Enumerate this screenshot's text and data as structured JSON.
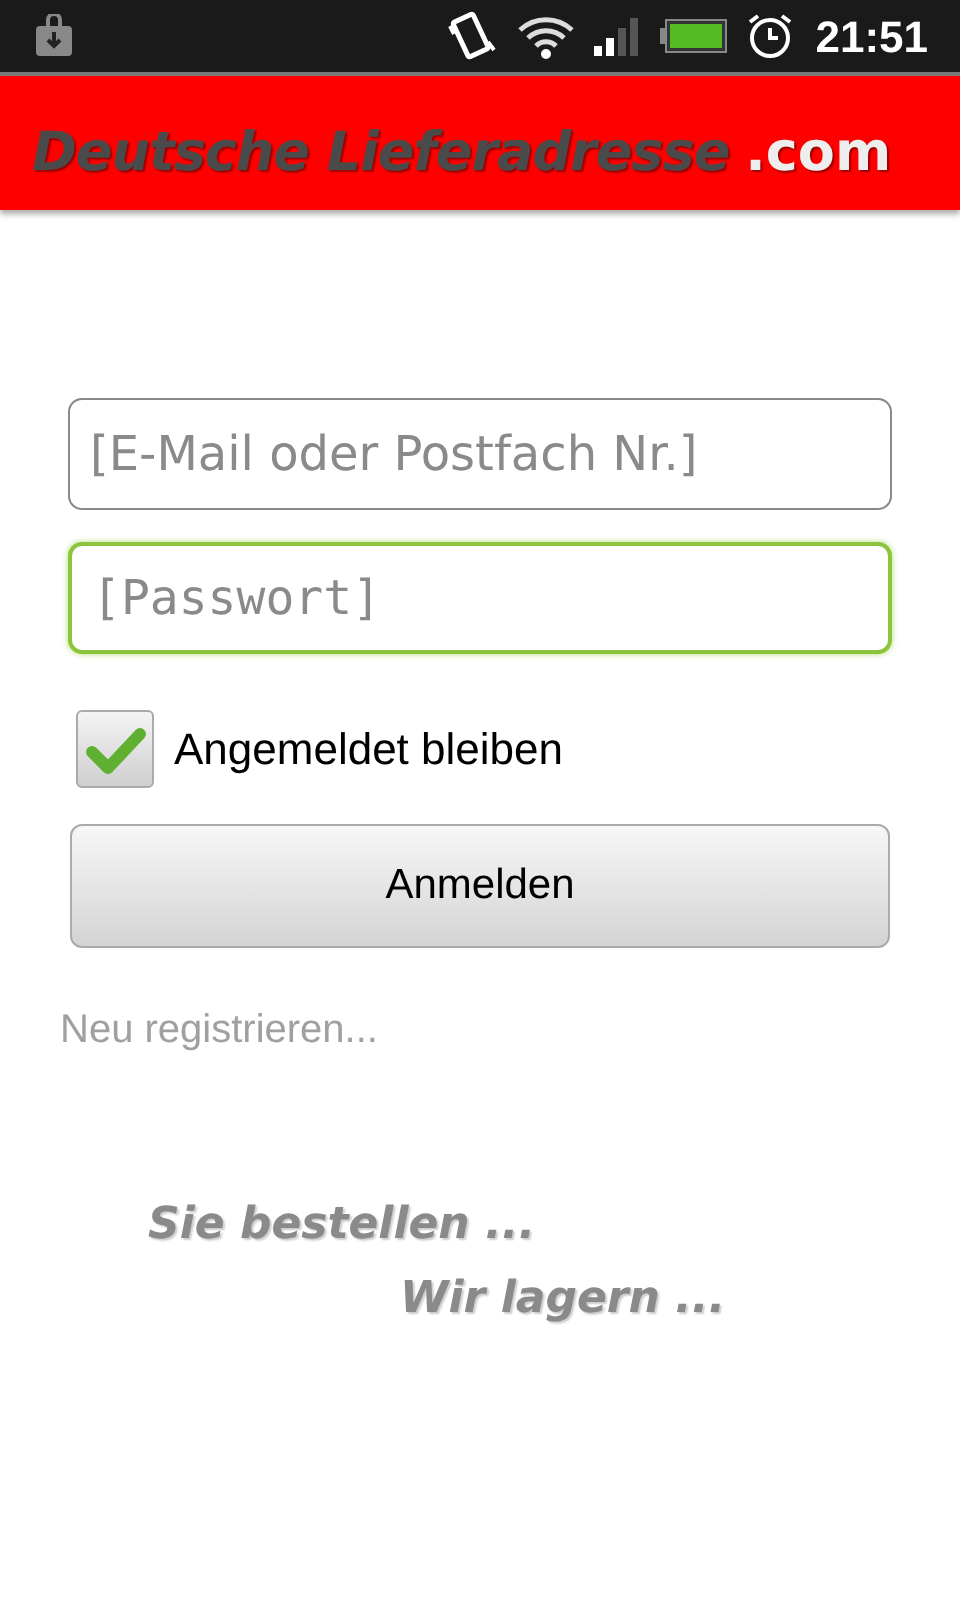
{
  "status_bar": {
    "time": "21:51"
  },
  "header": {
    "logo": "Deutsche Lieferadresse",
    "logo_suffix": ".com"
  },
  "fields": [
    {
      "placeholder": "[E-Mail oder Postfach Nr.]",
      "kind": "text",
      "focused": false
    },
    {
      "placeholder": "[Passwort]",
      "kind": "password",
      "focused": true
    }
  ],
  "remember": {
    "label": "Angemeldet bleiben",
    "checked": true
  },
  "login_button": "Anmelden",
  "register_link": "Neu registrieren...",
  "slogan": [
    "Sie bestellen ...",
    "Wir lagern ..."
  ]
}
